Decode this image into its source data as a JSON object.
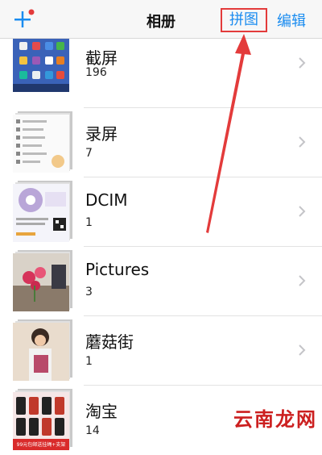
{
  "navbar": {
    "title": "相册",
    "left_icon": "plus-icon",
    "collage_label": "拼图",
    "edit_label": "编辑",
    "accent_color": "#1a8cf0",
    "highlight_color": "#e33b3b"
  },
  "albums": [
    {
      "name": "截屏",
      "count": "196",
      "thumb_icon": "screenshot-thumbnail"
    },
    {
      "name": "录屏",
      "count": "7",
      "thumb_icon": "screen-recording-thumbnail"
    },
    {
      "name": "DCIM",
      "count": "1",
      "thumb_icon": "camera-roll-thumbnail"
    },
    {
      "name": "Pictures",
      "count": "3",
      "thumb_icon": "flowers-photo-thumbnail"
    },
    {
      "name": "蘑菇街",
      "count": "1",
      "thumb_icon": "portrait-photo-thumbnail"
    },
    {
      "name": "淘宝",
      "count": "14",
      "thumb_icon": "phone-cases-thumbnail"
    }
  ],
  "thumb_texts": {
    "taobao_banner": "99元包邮送挂绳+支架"
  },
  "watermark": "云南龙网"
}
